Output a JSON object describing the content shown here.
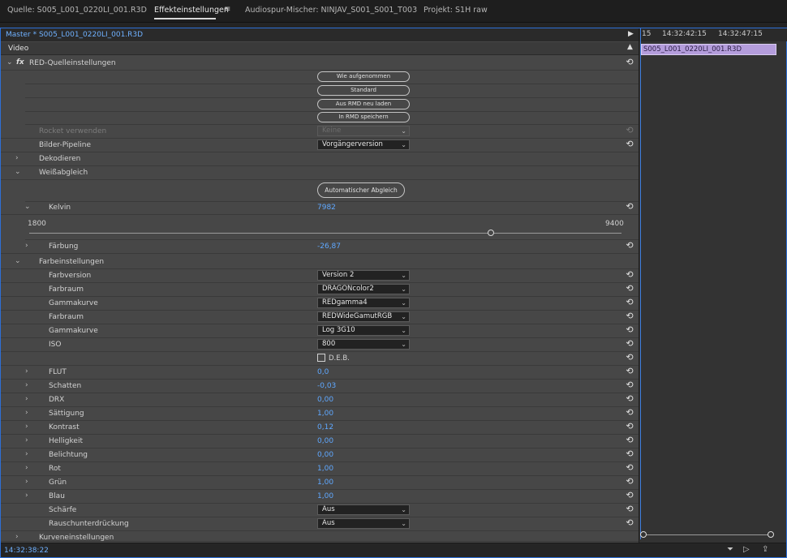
{
  "tabs": [
    {
      "label": "Quelle: S005_L001_0220LI_001.R3D"
    },
    {
      "label": "Effekteinstellungen",
      "active": true
    },
    {
      "label": "Audiospur-Mischer: NINJAV_S001_S001_T003"
    },
    {
      "label": "Projekt: S1H raw"
    }
  ],
  "panel": {
    "clip_name": "Master * S005_L001_0220LI_001.R3D",
    "section": "Video",
    "effect": "RED-Quelleinstellungen"
  },
  "buttons": {
    "as_shot": "Wie aufgenommen",
    "default": "Standard",
    "reload_rmd": "Aus RMD neu laden",
    "save_rmd": "In RMD speichern",
    "auto_balance": "Automatischer Abgleich"
  },
  "rows": {
    "rocket": {
      "label": "Rocket verwenden",
      "value": "Keine"
    },
    "pipeline": {
      "label": "Bilder-Pipeline",
      "value": "Vorgängerversion"
    },
    "decode": {
      "label": "Dekodieren"
    },
    "whitebalance": {
      "label": "Weißabgleich"
    },
    "kelvin": {
      "label": "Kelvin",
      "value": "7982",
      "min": "1800",
      "max": "9400",
      "level": 0.78
    },
    "tint": {
      "label": "Färbung",
      "value": "-26,87"
    },
    "colorsettings": {
      "label": "Farbeinstellungen"
    },
    "colorversion": {
      "label": "Farbversion",
      "value": "Version 2"
    },
    "colorspace1": {
      "label": "Farbraum",
      "value": "DRAGONcolor2"
    },
    "gamma1": {
      "label": "Gammakurve",
      "value": "REDgamma4"
    },
    "colorspace2": {
      "label": "Farbraum",
      "value": "REDWideGamutRGB"
    },
    "gamma2": {
      "label": "Gammakurve",
      "value": "Log 3G10"
    },
    "iso": {
      "label": "ISO",
      "value": "800"
    },
    "deb": {
      "label": "D.E.B."
    },
    "flut": {
      "label": "FLUT",
      "value": "0,0"
    },
    "shadows": {
      "label": "Schatten",
      "value": "-0,03"
    },
    "drx": {
      "label": "DRX",
      "value": "0,00"
    },
    "saturation": {
      "label": "Sättigung",
      "value": "1,00"
    },
    "contrast": {
      "label": "Kontrast",
      "value": "0,12"
    },
    "brightness": {
      "label": "Helligkeit",
      "value": "0,00"
    },
    "exposure": {
      "label": "Belichtung",
      "value": "0,00"
    },
    "red": {
      "label": "Rot",
      "value": "1,00"
    },
    "green": {
      "label": "Grün",
      "value": "1,00"
    },
    "blue": {
      "label": "Blau",
      "value": "1,00"
    },
    "sharpness": {
      "label": "Schärfe",
      "value": "Aus"
    },
    "noise": {
      "label": "Rauschunterdrückung",
      "value": "Aus"
    },
    "curves": {
      "label": "Kurveneinstellungen"
    }
  },
  "timeline": {
    "ruler_left": "15",
    "ruler_mid": "14:32:42:15",
    "ruler_right": "14:32:47:15",
    "clip": "S005_L001_0220LI_001.R3D"
  },
  "status": {
    "timecode": "14:32:38:22"
  }
}
